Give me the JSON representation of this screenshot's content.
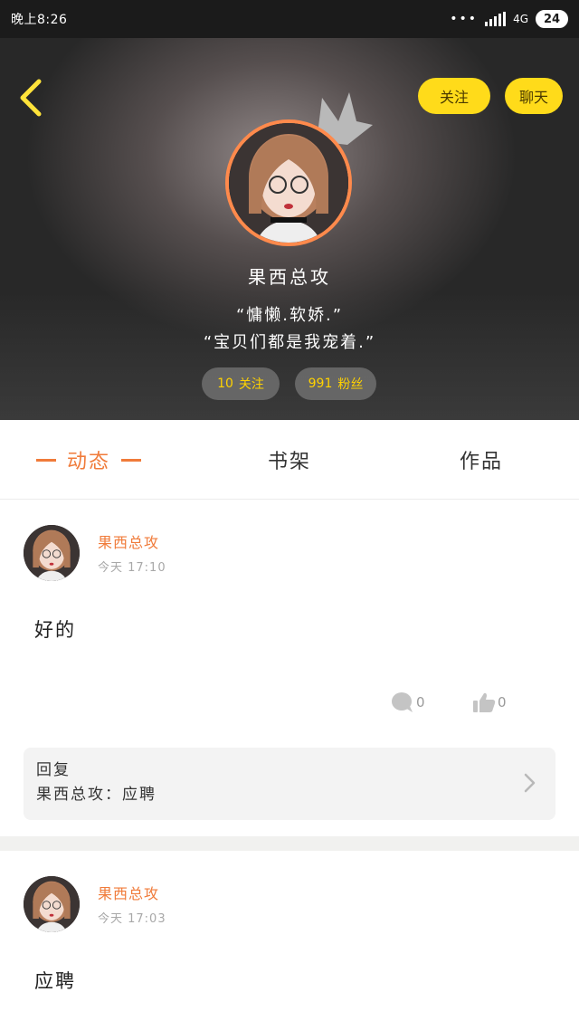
{
  "status_bar": {
    "time": "晚上8:26",
    "dots": "•••",
    "network": "4G",
    "battery": "24"
  },
  "header": {
    "follow_label": "关注",
    "chat_label": "聊天",
    "profile_name": "果西总攻",
    "bio_line_1": "“慵懒.软娇.”",
    "bio_line_2": "“宝贝们都是我宠着.”",
    "following_count": "10",
    "following_label": "关注",
    "fans_count": "991",
    "fans_label": "粉丝"
  },
  "tabs": [
    {
      "label": "动态",
      "active": true
    },
    {
      "label": "书架",
      "active": false
    },
    {
      "label": "作品",
      "active": false
    }
  ],
  "posts": [
    {
      "author": "果西总攻",
      "time": "今天 17:10",
      "content": "好的",
      "comment_count": "0",
      "like_count": "0",
      "reply": {
        "title": "回复",
        "author": "果西总攻",
        "separator": "：",
        "text": "应聘"
      }
    },
    {
      "author": "果西总攻",
      "time": "今天 17:03",
      "content": "应聘"
    }
  ],
  "colors": {
    "accent": "#f07b3a",
    "button_yellow": "#ffdb1a",
    "stat_yellow": "#ffd200"
  },
  "icons": {
    "back": "chevron-left-icon",
    "crown": "crown-icon",
    "comment": "comment-icon",
    "like": "thumbs-up-icon",
    "reply_arrow": "chevron-right-icon"
  }
}
